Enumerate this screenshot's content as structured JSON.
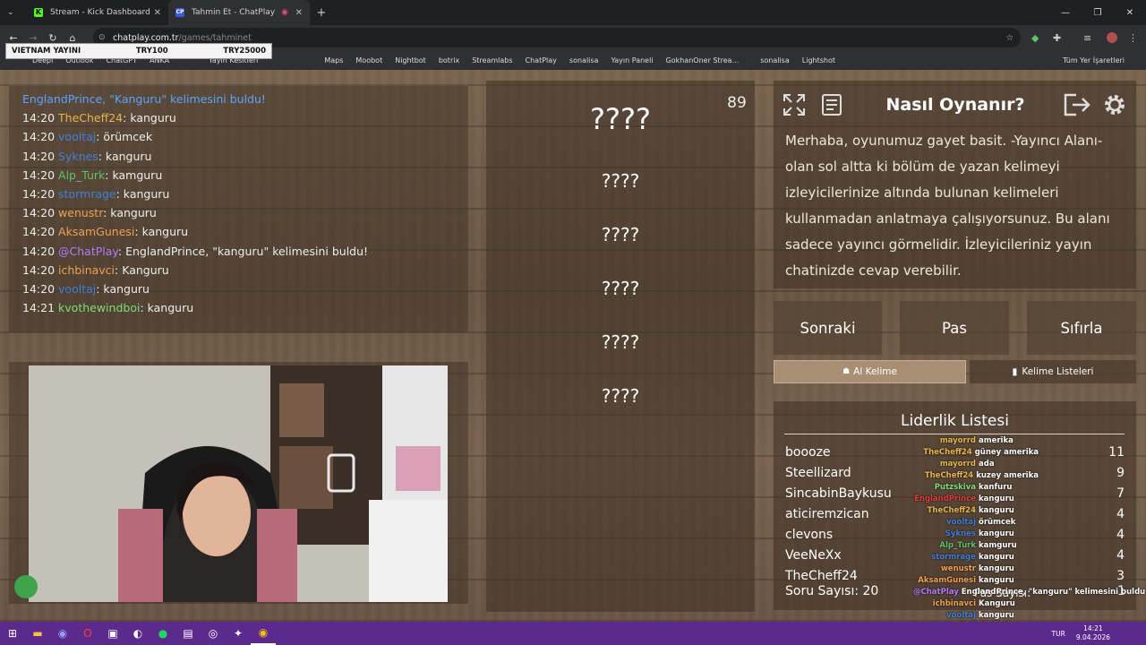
{
  "browser": {
    "tabs": [
      {
        "label": "Stream - Kick Dashboard",
        "active": false
      },
      {
        "label": "Tahmin Et - ChatPlay",
        "active": true
      }
    ],
    "url_host": "chatplay.com.tr",
    "url_path": "/games/tahminet",
    "bookmarks": [
      "Deepl",
      "Outlook",
      "ChatGPT",
      "ANKA",
      "Yayın Kesitleri",
      "Maps",
      "Moobot",
      "Nightbot",
      "botrix",
      "Streamlabs",
      "ChatPlay",
      "sonalisa",
      "Yayın Paneli",
      "GokhanOner Strea...",
      "sonalisa",
      "Lightshot"
    ],
    "bookmarks_all": "Tüm Yer İşaretleri"
  },
  "stream_overlay": {
    "left": "VIETNAM YAYINI",
    "mid": "TRY100",
    "right": "TRY25000"
  },
  "chat": [
    {
      "time": "",
      "user": "EnglandPrince, ",
      "ucolor": "#5aa3ff",
      "msg": "\"Kanguru\" kelimesini buldu!",
      "mcolor": "#5aa3ff"
    },
    {
      "time": "14:20",
      "user": "TheCheff24",
      "ucolor": "#e8b54a",
      "msg": ": kanguru"
    },
    {
      "time": "14:20",
      "user": "vooltaj",
      "ucolor": "#3f7fd9",
      "msg": ": örümcek"
    },
    {
      "time": "14:20",
      "user": "Syknes",
      "ucolor": "#3f7fd9",
      "msg": ": kanguru"
    },
    {
      "time": "14:20",
      "user": "Alp_Turk",
      "ucolor": "#5ec26a",
      "msg": ": kamguru"
    },
    {
      "time": "14:20",
      "user": "stormrage",
      "ucolor": "#3f7fd9",
      "msg": ": kanguru"
    },
    {
      "time": "14:20",
      "user": "wenustr",
      "ucolor": "#f0a050",
      "msg": ": kanguru"
    },
    {
      "time": "14:20",
      "user": "AksamGunesi",
      "ucolor": "#f0a050",
      "msg": ": kanguru"
    },
    {
      "time": "14:20",
      "user": "@ChatPlay",
      "ucolor": "#b37bff",
      "msg": ": EnglandPrince, \"kanguru\" kelimesini buldu!"
    },
    {
      "time": "14:20",
      "user": "ichbinavci",
      "ucolor": "#f0a050",
      "msg": ": Kanguru"
    },
    {
      "time": "14:20",
      "user": "vooltaj",
      "ucolor": "#3f7fd9",
      "msg": ": kanguru"
    },
    {
      "time": "14:21",
      "user": "kvothewindboi",
      "ucolor": "#7ddc7d",
      "msg": ": kanguru"
    }
  ],
  "game": {
    "counter": "89",
    "hidden_words": [
      "????",
      "????",
      "????",
      "????",
      "????",
      "????"
    ]
  },
  "howto": {
    "title": "Nasıl Oynanır?",
    "text": "Merhaba, oyunumuz gayet basit. -Yayıncı Alanı- olan sol altta ki bölüm de yazan kelimeyi izleyicilerinize altında bulunan kelimeleri kullanmadan anlatmaya çalışıyorsunuz. Bu alanı sadece yayıncı görmelidir. İzleyicileriniz yayın chatinizde cevap verebilir."
  },
  "buttons": {
    "next": "Sonraki",
    "pass": "Pas",
    "reset": "Sıfırla",
    "ai": "Al Kelime",
    "lists": "Kelime Listeleri"
  },
  "leaderboard": {
    "title": "Liderlik Listesi",
    "rows": [
      {
        "name": "boooze",
        "score": "11"
      },
      {
        "name": "Steellizard",
        "score": "9"
      },
      {
        "name": "SincabinBaykusu",
        "score": "7"
      },
      {
        "name": "aticiremzican",
        "score": "4"
      },
      {
        "name": "clevons",
        "score": "4"
      },
      {
        "name": "VeeNeXx",
        "score": "4"
      },
      {
        "name": "TheCheff24",
        "score": "3"
      }
    ],
    "question_count": "Soru Sayısı: 20",
    "pass_count": "Pas Sayısı: ",
    "pass_value": "1"
  },
  "overlay_chat": [
    {
      "u": "mayorrd",
      "c": "#e8b54a",
      "m": "amerika"
    },
    {
      "u": "TheCheff24",
      "c": "#e8b54a",
      "m": "güney amerika"
    },
    {
      "u": "mayorrd",
      "c": "#e8b54a",
      "m": "ada"
    },
    {
      "u": "TheCheff24",
      "c": "#e8b54a",
      "m": "kuzey amerika"
    },
    {
      "u": "Putzskiva",
      "c": "#7ddc7d",
      "m": "kanfuru"
    },
    {
      "u": "EnglandPrince",
      "c": "#e83b3b",
      "m": "kanguru"
    },
    {
      "u": "TheCheff24",
      "c": "#e8b54a",
      "m": "kanguru"
    },
    {
      "u": "vooltaj",
      "c": "#3f7fd9",
      "m": "örümcek"
    },
    {
      "u": "Syknes",
      "c": "#3f7fd9",
      "m": "kanguru"
    },
    {
      "u": "Alp_Turk",
      "c": "#5ec26a",
      "m": "kamguru"
    },
    {
      "u": "stormrage",
      "c": "#3f7fd9",
      "m": "kanguru"
    },
    {
      "u": "wenustr",
      "c": "#f0a050",
      "m": "kanguru"
    },
    {
      "u": "AksamGunesi",
      "c": "#f0a050",
      "m": "kanguru"
    },
    {
      "u": "@ChatPlay",
      "c": "#b37bff",
      "m": "EnglandPrince, \"kanguru\" kelimesini buldu"
    },
    {
      "u": "ichbinavci",
      "c": "#f0a050",
      "m": "Kanguru"
    },
    {
      "u": "vooltaj",
      "c": "#3f7fd9",
      "m": "kanguru"
    },
    {
      "u": "kvothewindboi",
      "c": "#7ddc7d",
      "m": "kanguru"
    }
  ],
  "taskbar": {
    "lang": "TUR",
    "time": "14:21",
    "date": "9.04.2026"
  }
}
